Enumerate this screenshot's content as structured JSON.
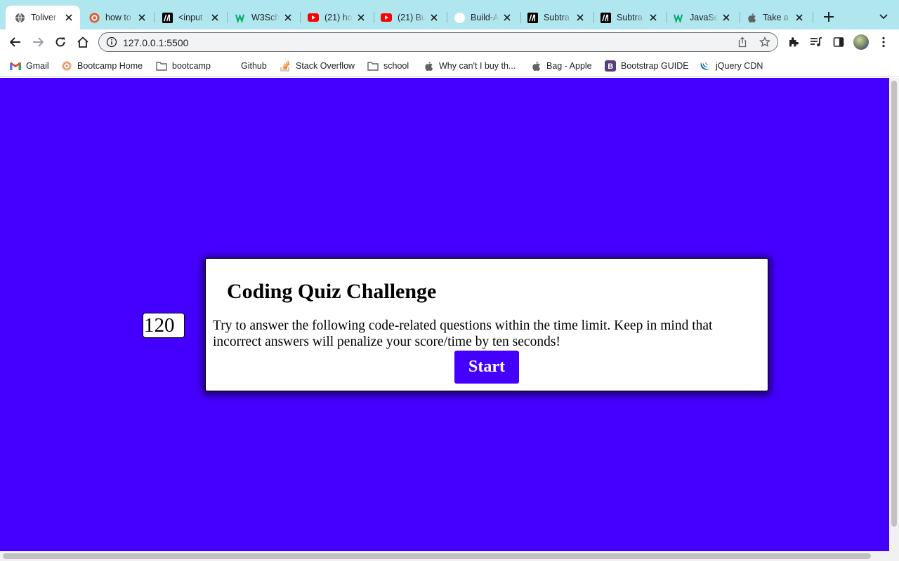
{
  "browser": {
    "tabs": [
      {
        "title": "Toliver",
        "favicon": "globe-icon",
        "active": true
      },
      {
        "title": "how to",
        "favicon": "duckduckgo-icon",
        "active": false
      },
      {
        "title": "<input",
        "favicon": "mdn-icon",
        "active": false
      },
      {
        "title": "W3Sch",
        "favicon": "w3schools-icon",
        "active": false
      },
      {
        "title": "(21) ho",
        "favicon": "youtube-icon",
        "active": false
      },
      {
        "title": "(21) Bu",
        "favicon": "youtube-icon",
        "active": false
      },
      {
        "title": "Build-A",
        "favicon": "github-icon",
        "active": false
      },
      {
        "title": "Subtra",
        "favicon": "mdn-icon",
        "active": false
      },
      {
        "title": "Subtra",
        "favicon": "mdn-icon",
        "active": false
      },
      {
        "title": "JavaSc",
        "favicon": "w3schools-icon",
        "active": false
      },
      {
        "title": "Take a",
        "favicon": "apple-icon",
        "active": false
      }
    ],
    "url": "127.0.0.1:5500",
    "bookmarks": [
      {
        "label": "Gmail",
        "icon": "gmail-icon"
      },
      {
        "label": "Bootcamp Home",
        "icon": "bootcamp-icon"
      },
      {
        "label": "bootcamp",
        "icon": "folder-icon"
      },
      {
        "label": "Github",
        "icon": "github-icon"
      },
      {
        "label": "Stack Overflow",
        "icon": "stackoverflow-icon"
      },
      {
        "label": "school",
        "icon": "folder-icon"
      },
      {
        "label": "Why can't I buy th...",
        "icon": "apple-icon"
      },
      {
        "label": "Bag - Apple",
        "icon": "apple-icon"
      },
      {
        "label": "Bootstrap GUIDE",
        "icon": "bootstrap-icon"
      },
      {
        "label": "jQuery CDN",
        "icon": "jquery-icon"
      }
    ]
  },
  "colors": {
    "page_background": "#4400ff",
    "tab_strip": "#b0e6ee",
    "button": "#4400ff"
  },
  "quiz": {
    "timer": "120",
    "title": "Coding Quiz Challenge",
    "description": "Try to answer the following code-related questions within the time limit. Keep in mind that incorrect answers will penalize your score/time by ten seconds!",
    "start_label": "Start"
  }
}
